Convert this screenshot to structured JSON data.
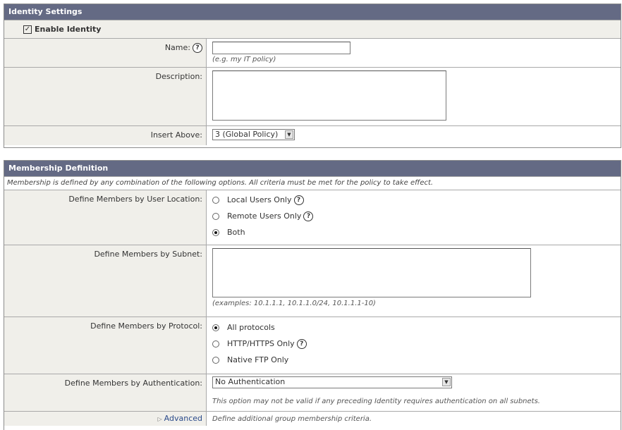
{
  "identity": {
    "header": "Identity Settings",
    "enable_label": "Enable Identity",
    "name_label": "Name:",
    "name_hint": "(e.g. my IT policy)",
    "description_label": "Description:",
    "insert_label": "Insert Above:",
    "insert_value": "3 (Global Policy)"
  },
  "membership": {
    "header": "Membership Definition",
    "intro": "Membership is defined by any combination of the following options. All criteria must be met for the policy to take effect.",
    "location_label": "Define Members by User Location:",
    "location_options": [
      "Local Users Only",
      "Remote Users Only",
      "Both"
    ],
    "location_selected": "Both",
    "subnet_label": "Define Members by Subnet:",
    "subnet_hint": "(examples: 10.1.1.1, 10.1.1.0/24, 10.1.1.1-10)",
    "protocol_label": "Define Members by Protocol:",
    "protocol_options": [
      "All protocols",
      "HTTP/HTTPS Only",
      "Native FTP Only"
    ],
    "protocol_selected": "All protocols",
    "auth_label": "Define Members by Authentication:",
    "auth_value": "No Authentication",
    "auth_hint": "This option may not be valid if any preceding Identity requires authentication on all subnets.",
    "advanced_label": "Advanced",
    "advanced_desc": "Define additional group membership criteria."
  },
  "icons": {
    "help": "?",
    "arrow": "▼",
    "expand": "▷"
  }
}
